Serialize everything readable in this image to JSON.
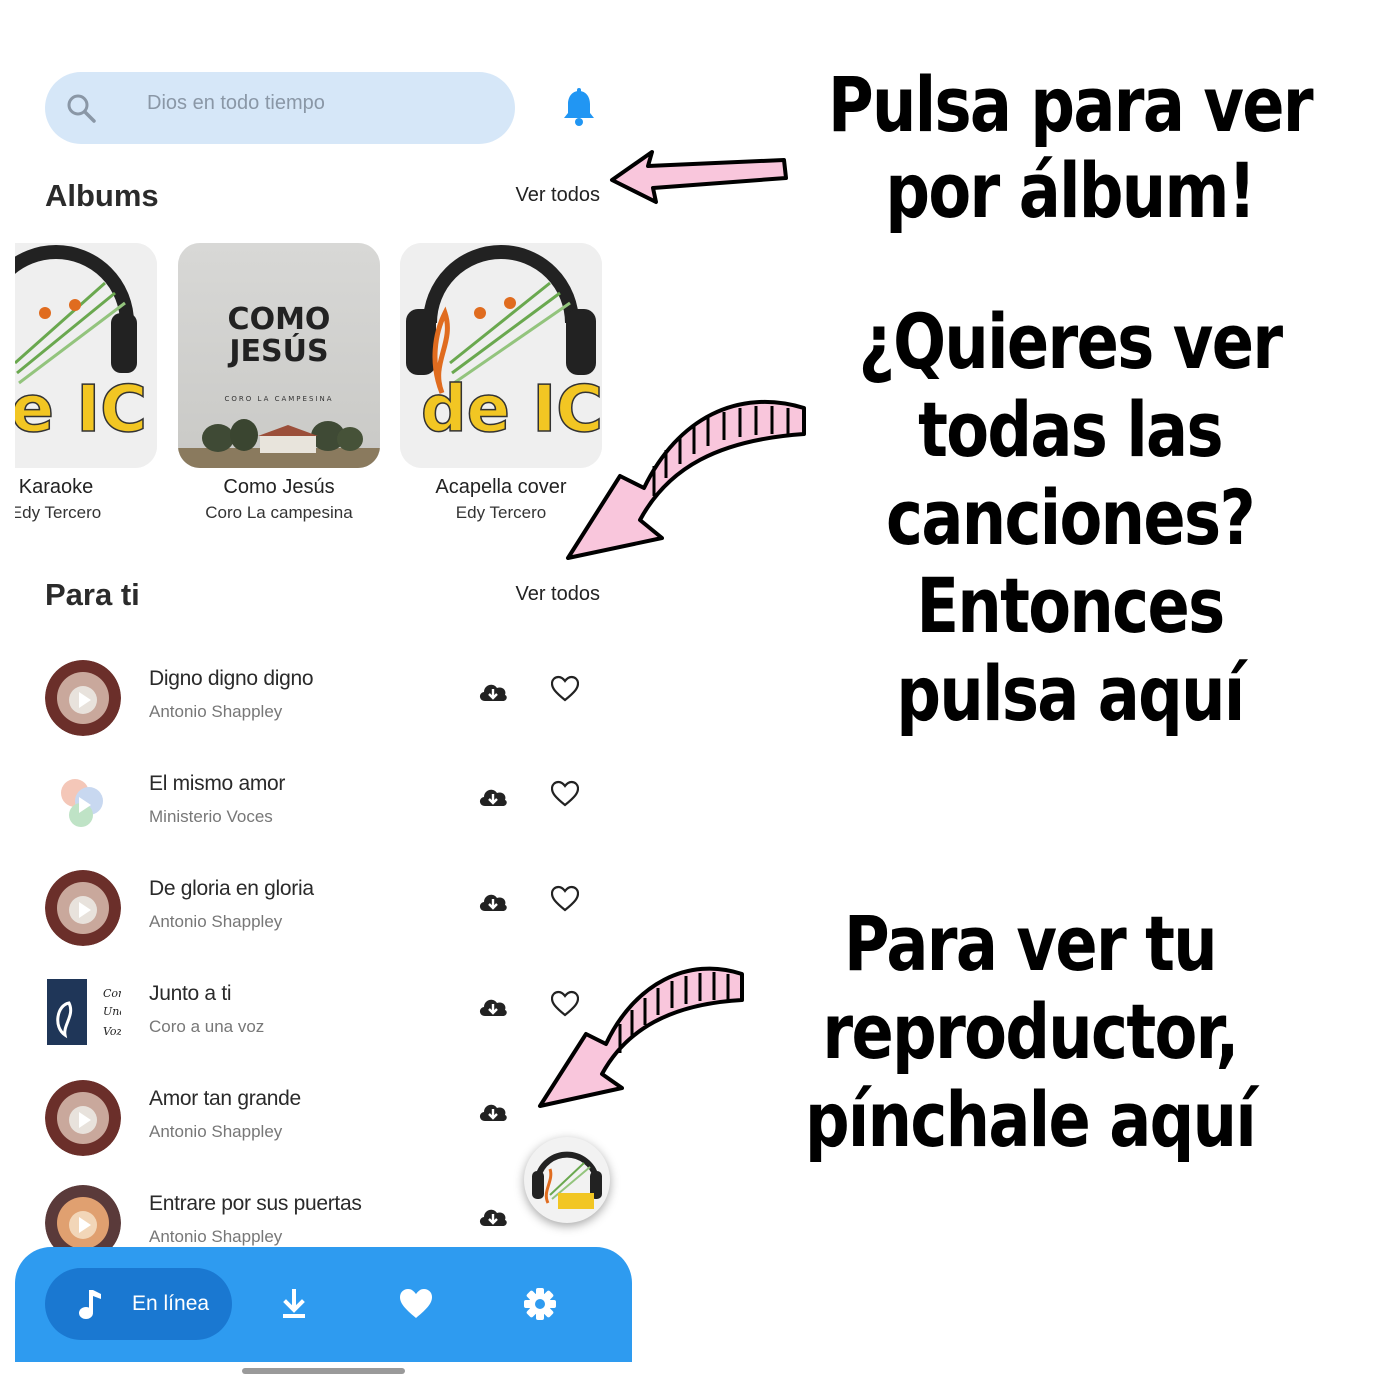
{
  "search": {
    "placeholder": "Dios en todo tiempo"
  },
  "albums_section": {
    "title": "Albums",
    "see_all": "Ver todos"
  },
  "albums": [
    {
      "title": "Karaoke",
      "artist": "Edy Tercero",
      "cover_text": "de IC"
    },
    {
      "title": "Como Jesús",
      "artist": "Coro La campesina",
      "cover_text_line1": "COMO",
      "cover_text_line2": "JESÚS",
      "cover_subtext": "CORO LA CAMPESINA"
    },
    {
      "title": "Acapella cover",
      "artist": "Edy Tercero",
      "cover_text": "de IC"
    }
  ],
  "foryou_section": {
    "title": "Para ti",
    "see_all": "Ver todos"
  },
  "songs": [
    {
      "title": "Digno digno digno",
      "artist": "Antonio Shappley"
    },
    {
      "title": "El mismo amor",
      "artist": "Ministerio Voces"
    },
    {
      "title": "De gloria en gloria",
      "artist": "Antonio Shappley"
    },
    {
      "title": "Junto a ti",
      "artist": "Coro a una voz"
    },
    {
      "title": "Amor tan grande",
      "artist": "Antonio Shappley"
    },
    {
      "title": "Entrare por sus puertas",
      "artist": "Antonio Shappley"
    }
  ],
  "bottom_nav": {
    "active_label": "En línea",
    "items": [
      "music-icon",
      "download-icon",
      "heart-icon",
      "settings-icon"
    ]
  },
  "annotations": {
    "album_tip": [
      "Pulsa para ver",
      "por álbum!"
    ],
    "songs_tip": [
      "¿Quieres ver",
      "todas las",
      "canciones?",
      "Entonces",
      "pulsa aquí"
    ],
    "player_tip": [
      "Para ver tu",
      "reproductor,",
      "pínchale aquí"
    ]
  },
  "colors": {
    "search_bg": "#d6e7f8",
    "accent_blue": "#2e9bf0",
    "accent_blue_dark": "#1a78d1",
    "bell": "#2196f3",
    "arrow_pink": "#f9c6dc"
  }
}
